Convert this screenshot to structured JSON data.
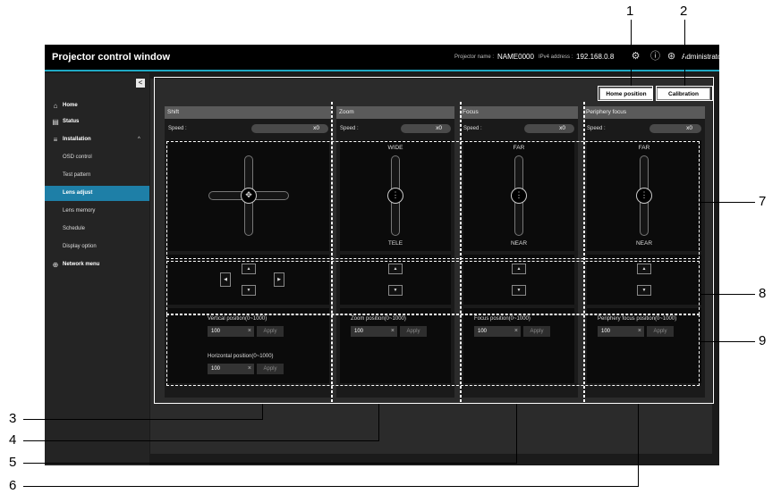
{
  "window": {
    "title": "Projector control window",
    "projector_name_label": "Projector name :",
    "projector_name": "NAME0000",
    "ipv4_label": "IPv4 address :",
    "ipv4": "192.168.0.8",
    "user": "Administrator"
  },
  "sidebar": {
    "collapse_glyph": "<",
    "items": [
      {
        "label": "Home",
        "icon": "home-icon"
      },
      {
        "label": "Status",
        "icon": "status-icon"
      },
      {
        "label": "Installation",
        "icon": "sliders-icon"
      },
      {
        "label": "OSD control"
      },
      {
        "label": "Test pattern"
      },
      {
        "label": "Lens adjust"
      },
      {
        "label": "Lens memory"
      },
      {
        "label": "Schedule"
      },
      {
        "label": "Display option"
      },
      {
        "label": "Network menu",
        "icon": "globe-icon"
      }
    ]
  },
  "header_buttons": {
    "home_position": "Home position",
    "calibration": "Calibration"
  },
  "panels": {
    "shift": {
      "title": "Shift",
      "speed_label": "Speed :",
      "speed_value": "x0",
      "vertical_label": "Vertical position(0~1000)",
      "vertical_value": "100",
      "horizontal_label": "Horizontal position(0~1000)",
      "horizontal_value": "100",
      "apply": "Apply"
    },
    "zoom": {
      "title": "Zoom",
      "speed_label": "Speed :",
      "speed_value": "x0",
      "top_label": "WIDE",
      "bottom_label": "TELE",
      "position_label": "Zoom position(0~1000)",
      "position_value": "100",
      "apply": "Apply"
    },
    "focus": {
      "title": "Focus",
      "speed_label": "Speed :",
      "speed_value": "x0",
      "top_label": "FAR",
      "bottom_label": "NEAR",
      "position_label": "Focus position(0~1000)",
      "position_value": "100",
      "apply": "Apply"
    },
    "periphery": {
      "title": "Periphery focus",
      "speed_label": "Speed :",
      "speed_value": "x0",
      "top_label": "FAR",
      "bottom_label": "NEAR",
      "position_label": "Periphery focus position(0~1000)",
      "position_value": "100",
      "apply": "Apply"
    }
  },
  "glyphs": {
    "up": "▲",
    "down": "▼",
    "left": "◀",
    "right": "▶",
    "clear": "×",
    "knob_move": "✥",
    "knob_slide": "⋮",
    "chevron_up": "^",
    "gear": "⚙",
    "info": "ⓘ",
    "user": "⊛",
    "home": "⌂",
    "status": "▤",
    "sliders": "≡",
    "globe": "⊕"
  },
  "callouts": [
    "1",
    "2",
    "3",
    "4",
    "5",
    "6",
    "7",
    "8",
    "9"
  ]
}
